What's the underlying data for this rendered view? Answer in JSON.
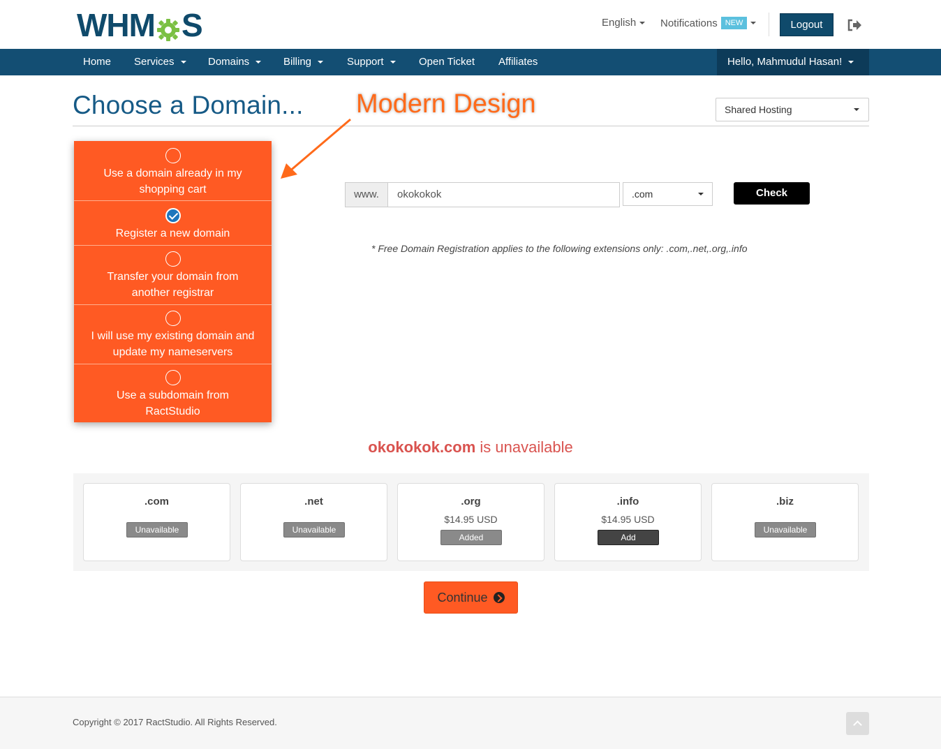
{
  "header": {
    "logo_text_before": "WHM",
    "logo_text_after": "S",
    "language": "English",
    "notifications_label": "Notifications",
    "notifications_badge": "NEW",
    "logout_label": "Logout"
  },
  "nav": {
    "items": [
      {
        "label": "Home",
        "dropdown": false
      },
      {
        "label": "Services",
        "dropdown": true
      },
      {
        "label": "Domains",
        "dropdown": true
      },
      {
        "label": "Billing",
        "dropdown": true
      },
      {
        "label": "Support",
        "dropdown": true
      },
      {
        "label": "Open Ticket",
        "dropdown": false
      },
      {
        "label": "Affiliates",
        "dropdown": false
      }
    ],
    "user_greeting": "Hello, Mahmudul Hasan!"
  },
  "page": {
    "title": "Choose a Domain...",
    "product_select": "Shared Hosting",
    "annotation": "Modern Design"
  },
  "domain_options": [
    {
      "label": "Use a domain already in my shopping cart",
      "checked": false
    },
    {
      "label": "Register a new domain",
      "checked": true
    },
    {
      "label": "Transfer your domain from another registrar",
      "checked": false
    },
    {
      "label": "I will use my existing domain and update my nameservers",
      "checked": false
    },
    {
      "label": "Use a subdomain from RactStudio",
      "checked": false
    }
  ],
  "search": {
    "prefix": "www.",
    "domain_value": "okokokok",
    "tld_value": ".com",
    "check_label": "Check",
    "free_note": "* Free Domain Registration applies to the following extensions only: .com,.net,.org,.info"
  },
  "result": {
    "domain": "okokokok.com",
    "status_text": "is unavailable"
  },
  "tlds": [
    {
      "name": ".com",
      "price": "",
      "button": "Unavailable",
      "state": "unavailable"
    },
    {
      "name": ".net",
      "price": "",
      "button": "Unavailable",
      "state": "unavailable"
    },
    {
      "name": ".org",
      "price": "$14.95 USD",
      "button": "Added",
      "state": "added"
    },
    {
      "name": ".info",
      "price": "$14.95 USD",
      "button": "Add",
      "state": "add"
    },
    {
      "name": ".biz",
      "price": "",
      "button": "Unavailable",
      "state": "unavailable"
    }
  ],
  "continue_label": "Continue",
  "footer": {
    "copyright": "Copyright © 2017 RactStudio. All Rights Reserved."
  },
  "colors": {
    "brand_blue": "#134e73",
    "accent_orange": "#ff5a23",
    "error_red": "#d9534f"
  }
}
